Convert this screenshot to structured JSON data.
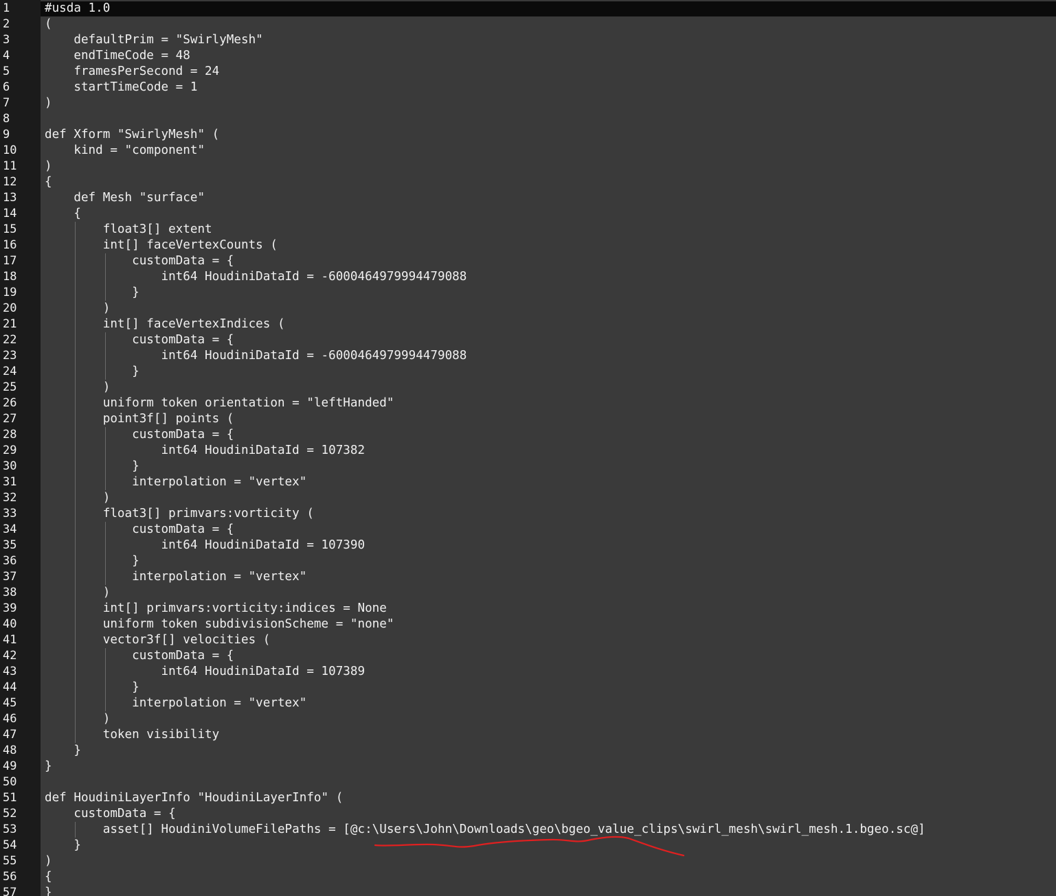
{
  "editor": {
    "annotation_color": "#e02020",
    "lines": [
      "#usda 1.0",
      "(",
      "    defaultPrim = \"SwirlyMesh\"",
      "    endTimeCode = 48",
      "    framesPerSecond = 24",
      "    startTimeCode = 1",
      ")",
      "",
      "def Xform \"SwirlyMesh\" (",
      "    kind = \"component\"",
      ")",
      "{",
      "    def Mesh \"surface\"",
      "    {",
      "        float3[] extent",
      "        int[] faceVertexCounts (",
      "            customData = {",
      "                int64 HoudiniDataId = -6000464979994479088",
      "            }",
      "        )",
      "        int[] faceVertexIndices (",
      "            customData = {",
      "                int64 HoudiniDataId = -6000464979994479088",
      "            }",
      "        )",
      "        uniform token orientation = \"leftHanded\"",
      "        point3f[] points (",
      "            customData = {",
      "                int64 HoudiniDataId = 107382",
      "            }",
      "            interpolation = \"vertex\"",
      "        )",
      "        float3[] primvars:vorticity (",
      "            customData = {",
      "                int64 HoudiniDataId = 107390",
      "            }",
      "            interpolation = \"vertex\"",
      "        )",
      "        int[] primvars:vorticity:indices = None",
      "        uniform token subdivisionScheme = \"none\"",
      "        vector3f[] velocities (",
      "            customData = {",
      "                int64 HoudiniDataId = 107389",
      "            }",
      "            interpolation = \"vertex\"",
      "        )",
      "        token visibility",
      "    }",
      "}",
      "",
      "def HoudiniLayerInfo \"HoudiniLayerInfo\" (",
      "    customData = {",
      "        asset[] HoudiniVolumeFilePaths = [@c:\\Users\\John\\Downloads\\geo\\bgeo_value_clips\\swirl_mesh\\swirl_mesh.1.bgeo.sc@]",
      "    }",
      ")",
      "{",
      "}"
    ]
  }
}
